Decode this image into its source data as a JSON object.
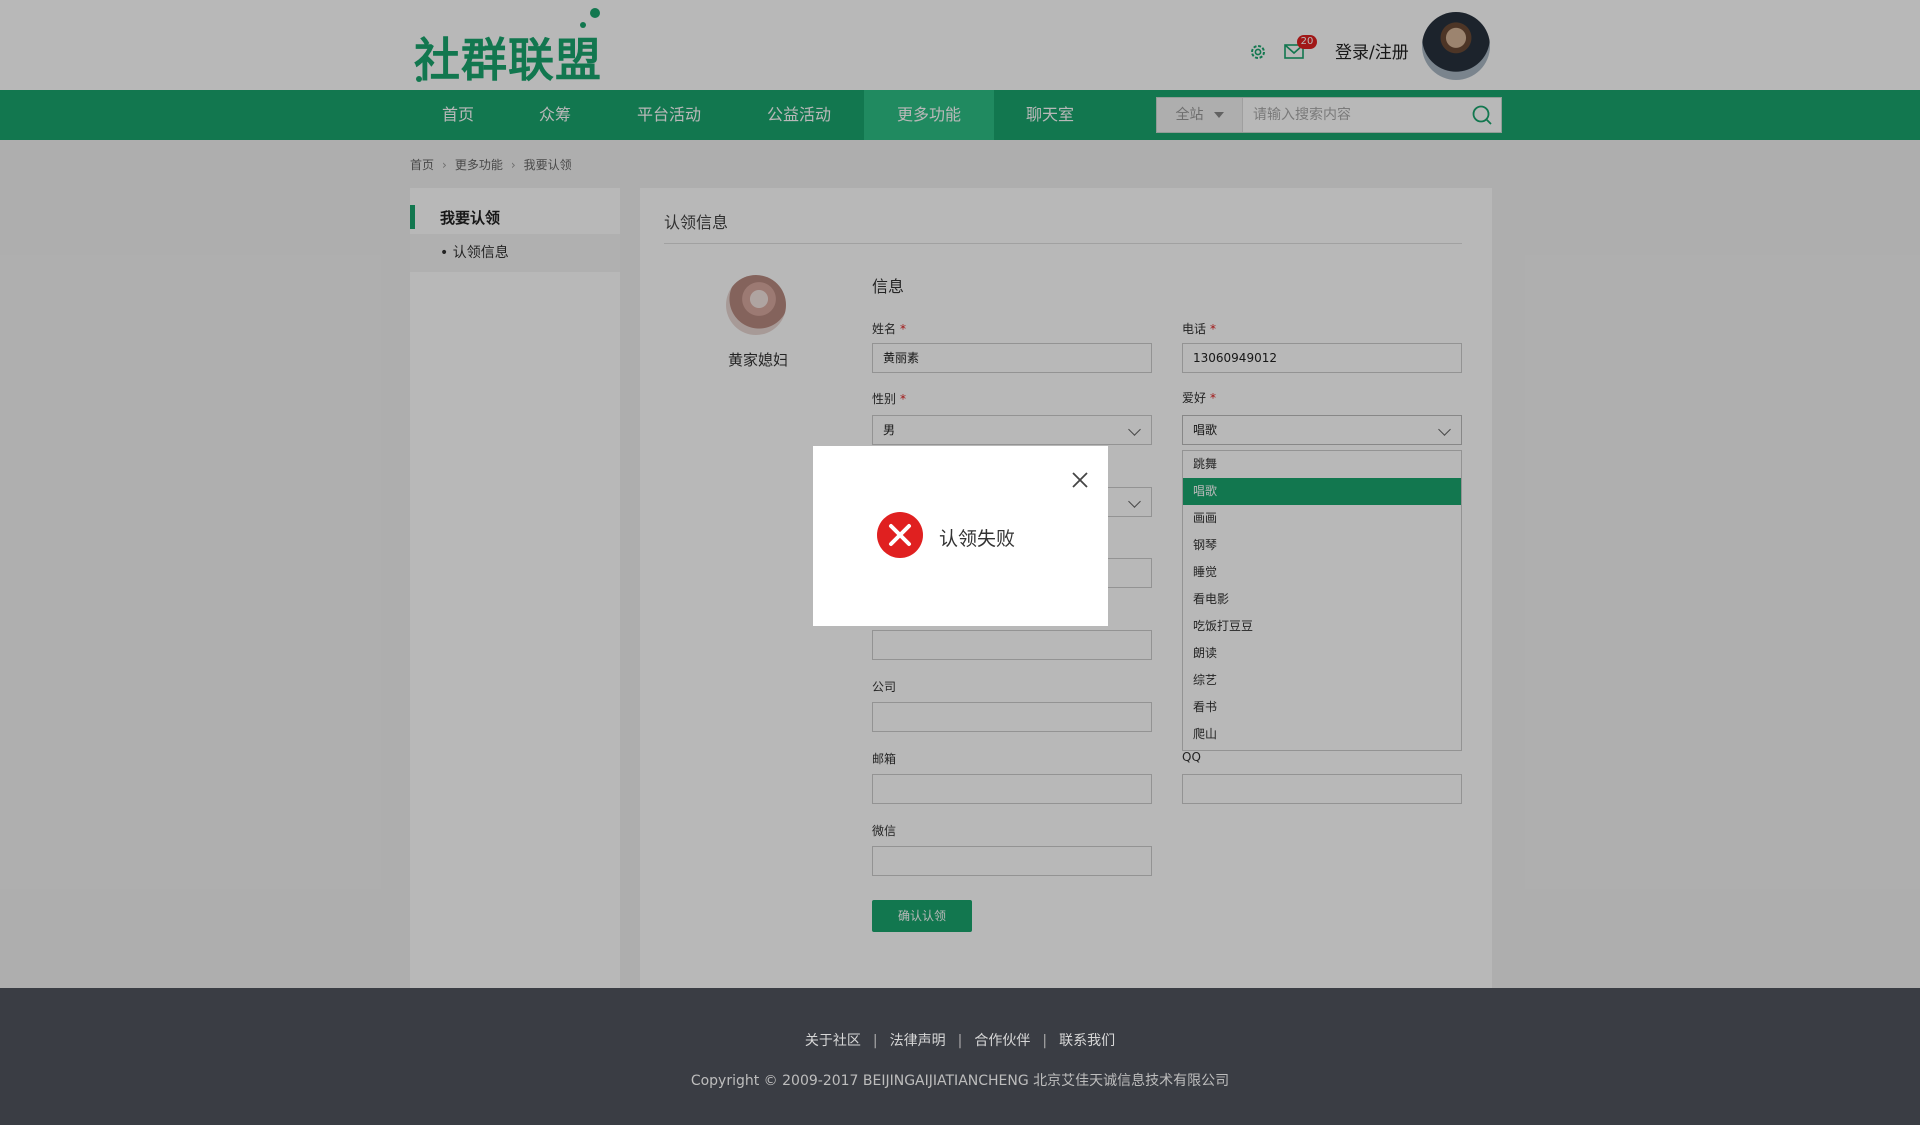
{
  "header": {
    "logo_text": "社群联盟",
    "mail_badge": "20",
    "login_label": "登录/注册"
  },
  "nav": {
    "items": [
      "首页",
      "众筹",
      "平台活动",
      "公益活动",
      "更多功能",
      "聊天室"
    ],
    "active": "更多功能",
    "search_scope": "全站",
    "search_placeholder": "请输入搜索内容"
  },
  "breadcrumb": [
    "首页",
    "更多功能",
    "我要认领"
  ],
  "sidebar": {
    "title": "我要认领",
    "sub_item": "• 认领信息"
  },
  "main": {
    "title": "认领信息",
    "profile_name": "黄家媳妇",
    "section_title": "信息",
    "fields": {
      "name_label": "姓名",
      "name_value": "黄丽素",
      "phone_label": "电话",
      "phone_value": "13060949012",
      "gender_label": "性别",
      "gender_value": "男",
      "hobby_label": "爱好",
      "hobby_value": "唱歌",
      "company_label": "公司",
      "email_label": "邮箱",
      "qq_label": "QQ",
      "wechat_label": "微信",
      "required_mark": "*"
    },
    "hobby_options": [
      "跳舞",
      "唱歌",
      "画画",
      "钢琴",
      "睡觉",
      "看电影",
      "吃饭打豆豆",
      "朗读",
      "综艺",
      "看书",
      "爬山"
    ],
    "hobby_selected": "唱歌",
    "confirm_label": "确认认领"
  },
  "modal": {
    "message": "认领失败"
  },
  "footer": {
    "links": [
      "关于社区",
      "法律声明",
      "合作伙伴",
      "联系我们"
    ],
    "link_separator": "|",
    "copyright": "Copyright © 2009-2017 BEIJINGAIJIATIANCHENG 北京艾佳天诚信息技术有限公司"
  },
  "colors": {
    "brand": "#1aa56e",
    "error": "#e02020",
    "footer_bg": "#3a3d44"
  }
}
